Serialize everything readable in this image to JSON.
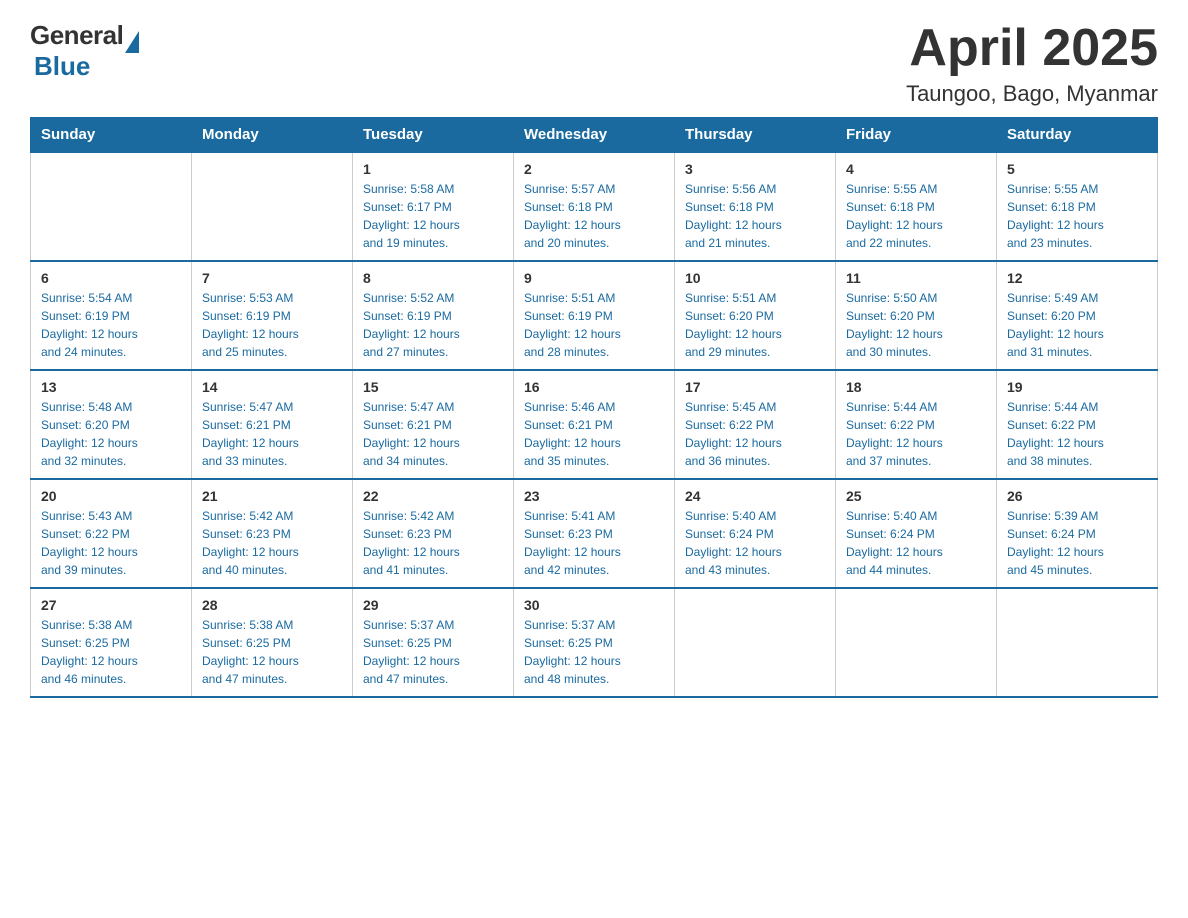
{
  "header": {
    "logo_general": "General",
    "logo_blue": "Blue",
    "month_title": "April 2025",
    "location": "Taungoo, Bago, Myanmar"
  },
  "days_of_week": [
    "Sunday",
    "Monday",
    "Tuesday",
    "Wednesday",
    "Thursday",
    "Friday",
    "Saturday"
  ],
  "weeks": [
    [
      {
        "day": "",
        "info": ""
      },
      {
        "day": "",
        "info": ""
      },
      {
        "day": "1",
        "info": "Sunrise: 5:58 AM\nSunset: 6:17 PM\nDaylight: 12 hours\nand 19 minutes."
      },
      {
        "day": "2",
        "info": "Sunrise: 5:57 AM\nSunset: 6:18 PM\nDaylight: 12 hours\nand 20 minutes."
      },
      {
        "day": "3",
        "info": "Sunrise: 5:56 AM\nSunset: 6:18 PM\nDaylight: 12 hours\nand 21 minutes."
      },
      {
        "day": "4",
        "info": "Sunrise: 5:55 AM\nSunset: 6:18 PM\nDaylight: 12 hours\nand 22 minutes."
      },
      {
        "day": "5",
        "info": "Sunrise: 5:55 AM\nSunset: 6:18 PM\nDaylight: 12 hours\nand 23 minutes."
      }
    ],
    [
      {
        "day": "6",
        "info": "Sunrise: 5:54 AM\nSunset: 6:19 PM\nDaylight: 12 hours\nand 24 minutes."
      },
      {
        "day": "7",
        "info": "Sunrise: 5:53 AM\nSunset: 6:19 PM\nDaylight: 12 hours\nand 25 minutes."
      },
      {
        "day": "8",
        "info": "Sunrise: 5:52 AM\nSunset: 6:19 PM\nDaylight: 12 hours\nand 27 minutes."
      },
      {
        "day": "9",
        "info": "Sunrise: 5:51 AM\nSunset: 6:19 PM\nDaylight: 12 hours\nand 28 minutes."
      },
      {
        "day": "10",
        "info": "Sunrise: 5:51 AM\nSunset: 6:20 PM\nDaylight: 12 hours\nand 29 minutes."
      },
      {
        "day": "11",
        "info": "Sunrise: 5:50 AM\nSunset: 6:20 PM\nDaylight: 12 hours\nand 30 minutes."
      },
      {
        "day": "12",
        "info": "Sunrise: 5:49 AM\nSunset: 6:20 PM\nDaylight: 12 hours\nand 31 minutes."
      }
    ],
    [
      {
        "day": "13",
        "info": "Sunrise: 5:48 AM\nSunset: 6:20 PM\nDaylight: 12 hours\nand 32 minutes."
      },
      {
        "day": "14",
        "info": "Sunrise: 5:47 AM\nSunset: 6:21 PM\nDaylight: 12 hours\nand 33 minutes."
      },
      {
        "day": "15",
        "info": "Sunrise: 5:47 AM\nSunset: 6:21 PM\nDaylight: 12 hours\nand 34 minutes."
      },
      {
        "day": "16",
        "info": "Sunrise: 5:46 AM\nSunset: 6:21 PM\nDaylight: 12 hours\nand 35 minutes."
      },
      {
        "day": "17",
        "info": "Sunrise: 5:45 AM\nSunset: 6:22 PM\nDaylight: 12 hours\nand 36 minutes."
      },
      {
        "day": "18",
        "info": "Sunrise: 5:44 AM\nSunset: 6:22 PM\nDaylight: 12 hours\nand 37 minutes."
      },
      {
        "day": "19",
        "info": "Sunrise: 5:44 AM\nSunset: 6:22 PM\nDaylight: 12 hours\nand 38 minutes."
      }
    ],
    [
      {
        "day": "20",
        "info": "Sunrise: 5:43 AM\nSunset: 6:22 PM\nDaylight: 12 hours\nand 39 minutes."
      },
      {
        "day": "21",
        "info": "Sunrise: 5:42 AM\nSunset: 6:23 PM\nDaylight: 12 hours\nand 40 minutes."
      },
      {
        "day": "22",
        "info": "Sunrise: 5:42 AM\nSunset: 6:23 PM\nDaylight: 12 hours\nand 41 minutes."
      },
      {
        "day": "23",
        "info": "Sunrise: 5:41 AM\nSunset: 6:23 PM\nDaylight: 12 hours\nand 42 minutes."
      },
      {
        "day": "24",
        "info": "Sunrise: 5:40 AM\nSunset: 6:24 PM\nDaylight: 12 hours\nand 43 minutes."
      },
      {
        "day": "25",
        "info": "Sunrise: 5:40 AM\nSunset: 6:24 PM\nDaylight: 12 hours\nand 44 minutes."
      },
      {
        "day": "26",
        "info": "Sunrise: 5:39 AM\nSunset: 6:24 PM\nDaylight: 12 hours\nand 45 minutes."
      }
    ],
    [
      {
        "day": "27",
        "info": "Sunrise: 5:38 AM\nSunset: 6:25 PM\nDaylight: 12 hours\nand 46 minutes."
      },
      {
        "day": "28",
        "info": "Sunrise: 5:38 AM\nSunset: 6:25 PM\nDaylight: 12 hours\nand 47 minutes."
      },
      {
        "day": "29",
        "info": "Sunrise: 5:37 AM\nSunset: 6:25 PM\nDaylight: 12 hours\nand 47 minutes."
      },
      {
        "day": "30",
        "info": "Sunrise: 5:37 AM\nSunset: 6:25 PM\nDaylight: 12 hours\nand 48 minutes."
      },
      {
        "day": "",
        "info": ""
      },
      {
        "day": "",
        "info": ""
      },
      {
        "day": "",
        "info": ""
      }
    ]
  ]
}
